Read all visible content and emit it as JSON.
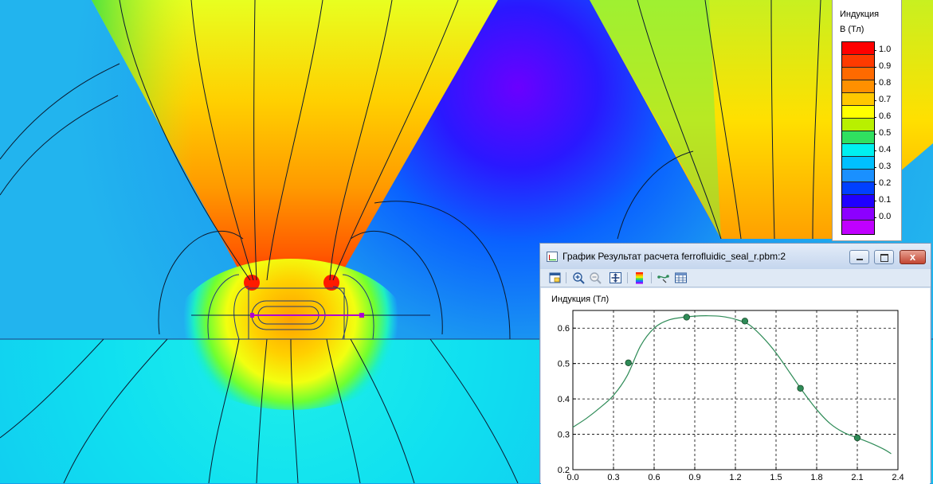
{
  "legend": {
    "title_line1": "Индукция",
    "title_line2": "B (Тл)",
    "ticks": [
      "1.0",
      "0.9",
      "0.8",
      "0.7",
      "0.6",
      "0.5",
      "0.4",
      "0.3",
      "0.2",
      "0.1",
      "0.0"
    ],
    "colors": [
      "#ff0000",
      "#ff3a00",
      "#ff6a00",
      "#ff9000",
      "#ffc800",
      "#ffff00",
      "#b8f000",
      "#30e060",
      "#00f0f0",
      "#00c0ff",
      "#1a90ff",
      "#0040ff",
      "#2000ff",
      "#8c00ff",
      "#c000ff"
    ]
  },
  "window": {
    "title": "График Результат расчета ferrofluidic_seal_r.pbm:2",
    "close_label": "x",
    "toolbar_icons": [
      "properties-icon",
      "zoom-in-icon",
      "zoom-out-icon",
      "zoom-fit-icon",
      "color-scale-icon",
      "curve-points-icon",
      "table-icon"
    ]
  },
  "chart_data": {
    "type": "line",
    "ylabel": "Индукция (Тл)",
    "xlabel": "",
    "xlim": [
      0.0,
      2.4
    ],
    "ylim": [
      0.2,
      0.65
    ],
    "xticks": [
      "0.0",
      "0.3",
      "0.6",
      "0.9",
      "1.2",
      "1.5",
      "1.8",
      "2.1",
      "2.4"
    ],
    "yticks": [
      "0.2",
      "0.3",
      "0.4",
      "0.5",
      "0.6"
    ],
    "grid": true,
    "series": [
      {
        "color": "#2e8b57",
        "x": [
          0.0,
          0.1,
          0.2,
          0.3,
          0.4,
          0.5,
          0.6,
          0.7,
          0.8,
          0.9,
          1.0,
          1.1,
          1.2,
          1.3,
          1.4,
          1.5,
          1.6,
          1.7,
          1.8,
          1.9,
          2.0,
          2.1,
          2.2,
          2.3,
          2.35
        ],
        "y": [
          0.32,
          0.345,
          0.375,
          0.41,
          0.465,
          0.55,
          0.6,
          0.622,
          0.63,
          0.634,
          0.635,
          0.633,
          0.625,
          0.61,
          0.575,
          0.53,
          0.475,
          0.42,
          0.37,
          0.33,
          0.305,
          0.29,
          0.275,
          0.257,
          0.245
        ]
      }
    ],
    "markers": [
      {
        "x": 0.41,
        "y": 0.502
      },
      {
        "x": 0.84,
        "y": 0.631
      },
      {
        "x": 1.27,
        "y": 0.62
      },
      {
        "x": 1.68,
        "y": 0.43
      },
      {
        "x": 2.1,
        "y": 0.29
      }
    ]
  }
}
